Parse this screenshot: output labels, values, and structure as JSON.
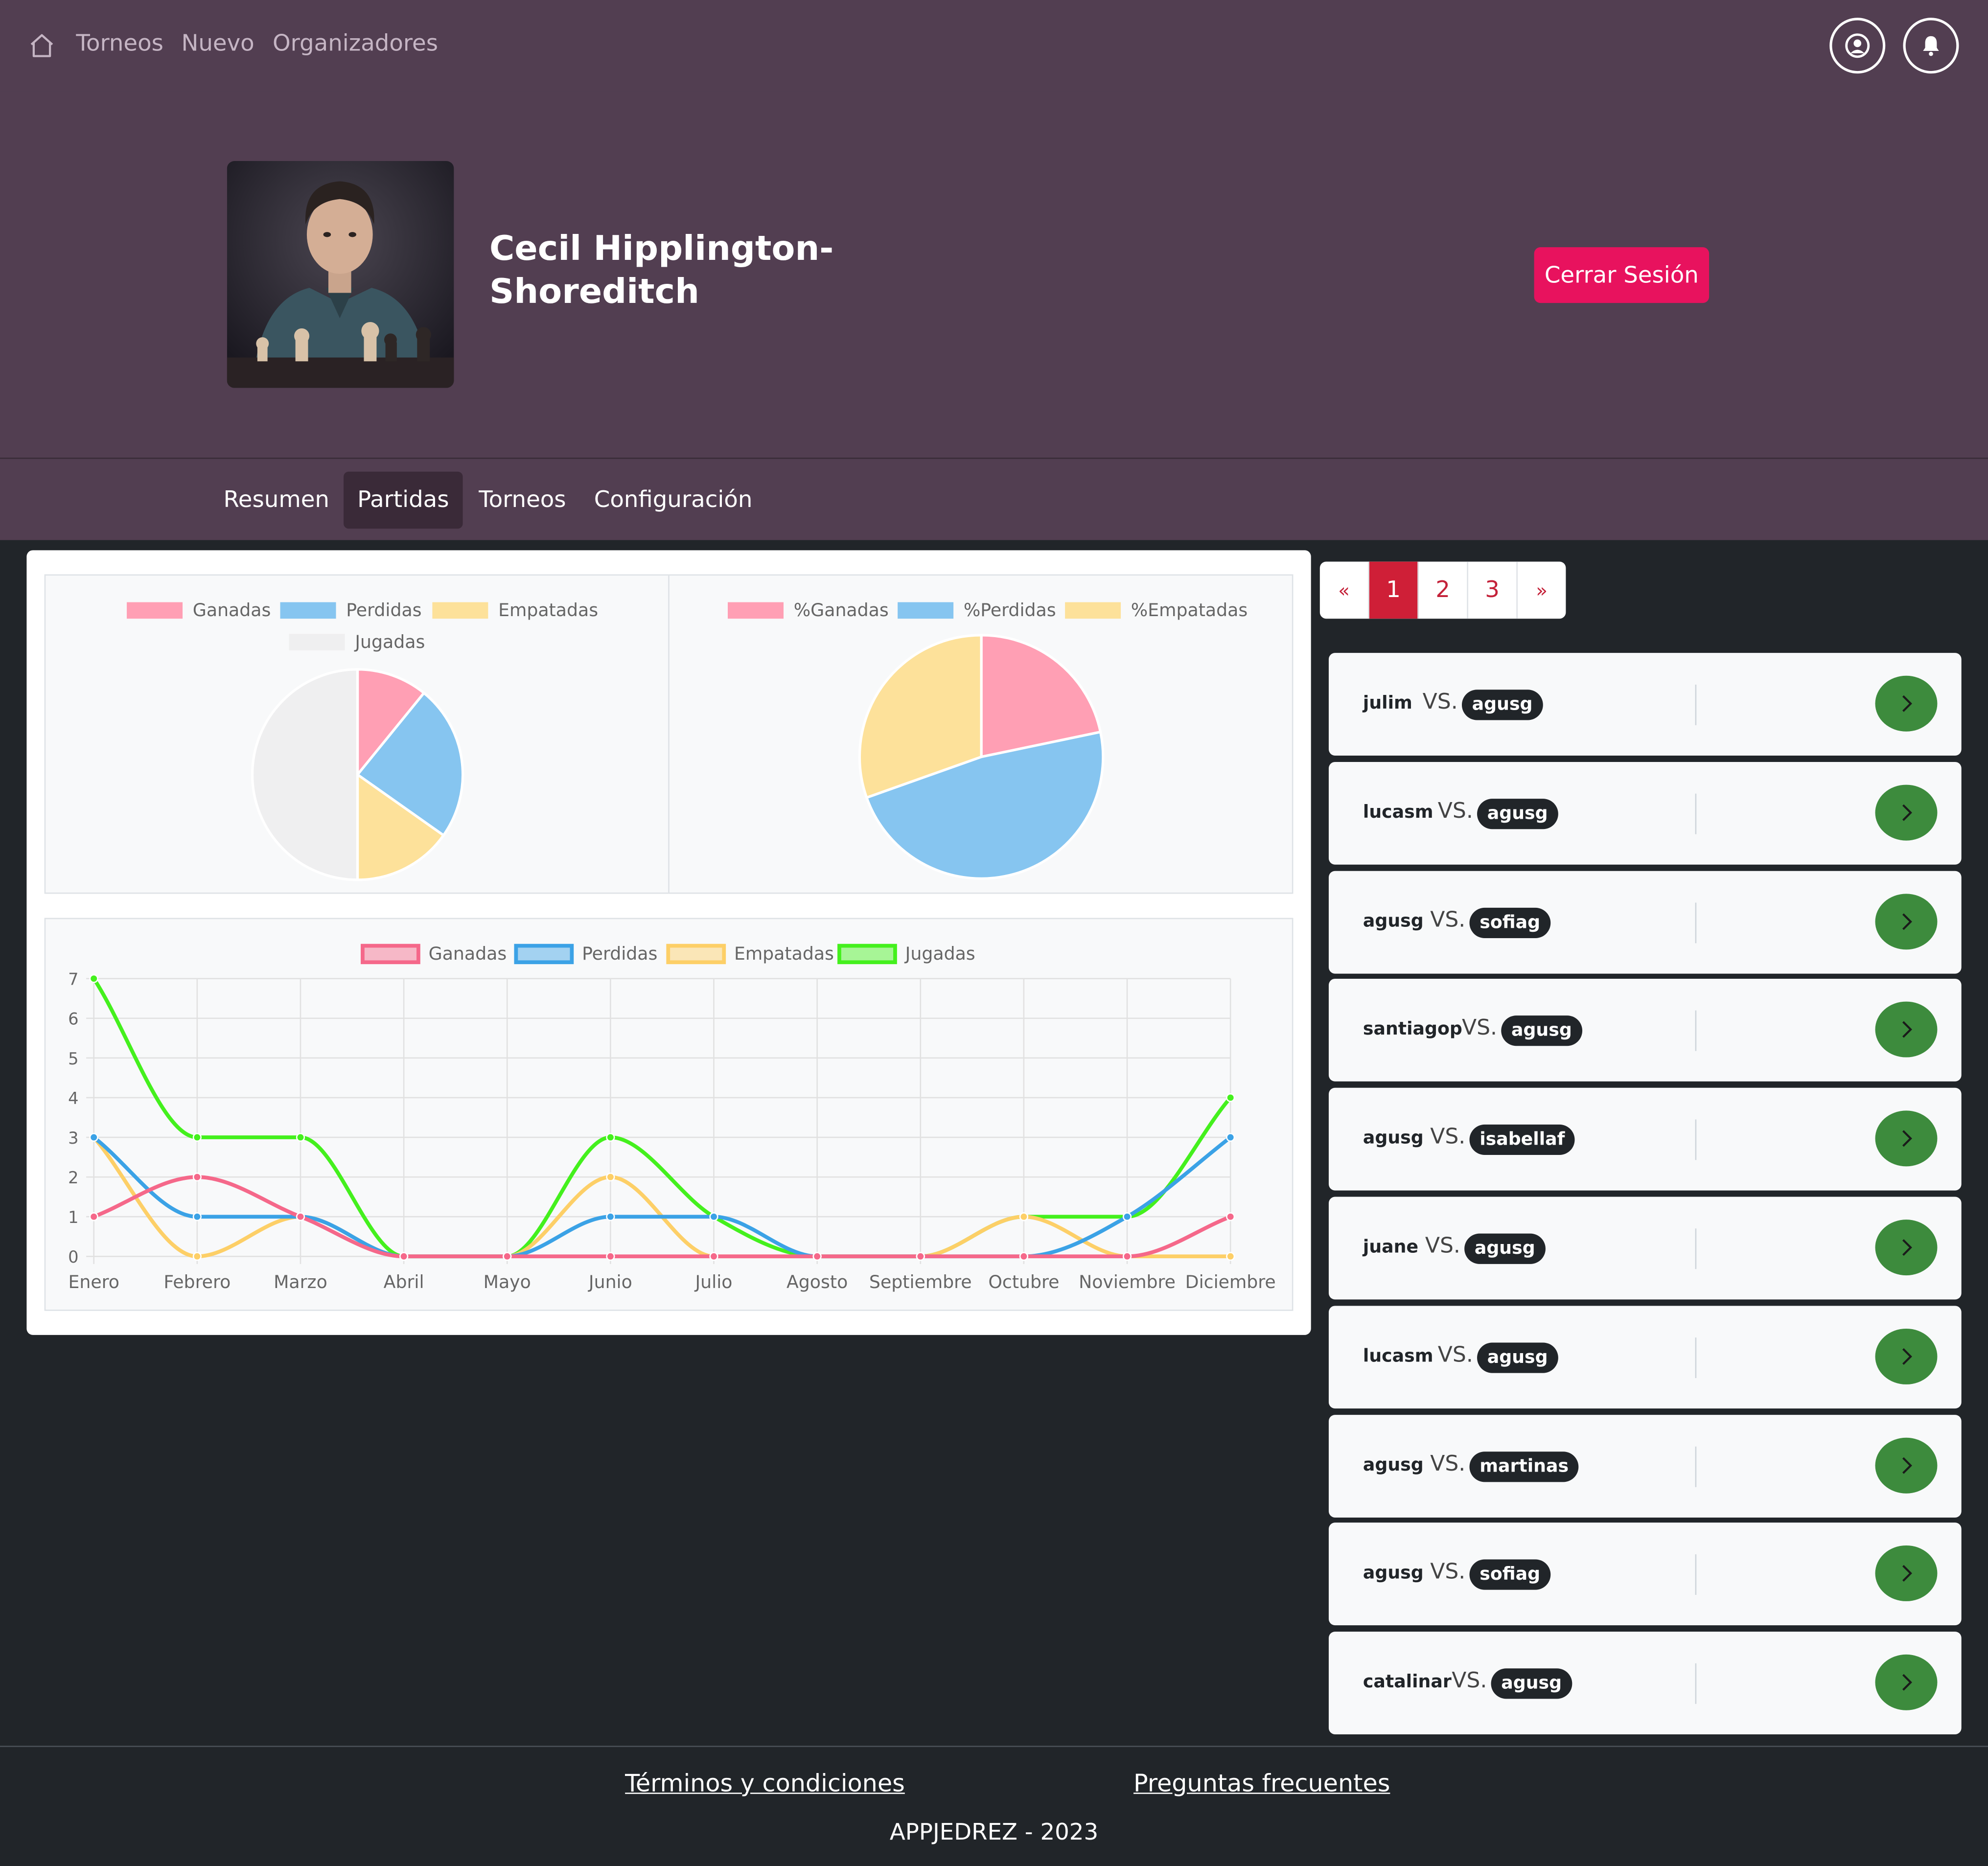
{
  "nav": {
    "home_icon": "home-icon",
    "links": [
      "Torneos",
      "Nuevo",
      "Organizadores"
    ],
    "user_icon": "user-circle-icon",
    "bell_icon": "bell-icon"
  },
  "profile": {
    "name": "Cecil Hipplington-Shoreditch",
    "logout_label": "Cerrar Sesión",
    "logout_color": "#e8125e"
  },
  "tabs": [
    {
      "label": "Resumen",
      "active": false
    },
    {
      "label": "Partidas",
      "active": true
    },
    {
      "label": "Torneos",
      "active": false
    },
    {
      "label": "Configuración",
      "active": false
    }
  ],
  "chart_data": [
    {
      "type": "pie",
      "legend": [
        "Ganadas",
        "Perdidas",
        "Empatadas",
        "Jugadas"
      ],
      "labels": [
        "Ganadas",
        "Perdidas",
        "Empatadas",
        "Jugadas"
      ],
      "values": [
        5,
        11,
        7,
        23
      ],
      "colors": [
        "#ff9fb4",
        "#86c5f0",
        "#fde19a",
        "#efeff0"
      ],
      "legend_position": "top"
    },
    {
      "type": "pie",
      "legend": [
        "%Ganadas",
        "%Perdidas",
        "%Empatadas"
      ],
      "labels": [
        "%Ganadas",
        "%Perdidas",
        "%Empatadas"
      ],
      "values": [
        21.7,
        47.8,
        30.4
      ],
      "colors": [
        "#ff9fb4",
        "#86c5f0",
        "#fde19a"
      ],
      "legend_position": "top"
    },
    {
      "type": "line",
      "categories": [
        "Enero",
        "Febrero",
        "Marzo",
        "Abril",
        "Mayo",
        "Junio",
        "Julio",
        "Agosto",
        "Septiembre",
        "Octubre",
        "Noviembre",
        "Diciembre"
      ],
      "series": [
        {
          "name": "Ganadas",
          "values": [
            1,
            2,
            1,
            0,
            0,
            0,
            0,
            0,
            0,
            0,
            0,
            1
          ],
          "color": "#f5688a"
        },
        {
          "name": "Perdidas",
          "values": [
            3,
            1,
            1,
            0,
            0,
            1,
            1,
            0,
            0,
            0,
            1,
            3
          ],
          "color": "#3ba2e6"
        },
        {
          "name": "Empatadas",
          "values": [
            3,
            0,
            1,
            0,
            0,
            2,
            0,
            0,
            0,
            1,
            0,
            0
          ],
          "color": "#fdcf67"
        },
        {
          "name": "Jugadas",
          "values": [
            7,
            3,
            3,
            0,
            0,
            3,
            1,
            0,
            0,
            1,
            1,
            4
          ],
          "color": "#44f01d"
        }
      ],
      "ylim": [
        0,
        7
      ],
      "yticks": [
        "0",
        "1",
        "2",
        "3",
        "4",
        "5",
        "6",
        "7"
      ],
      "grid": true,
      "legend_position": "top"
    }
  ],
  "pagination": {
    "prev": "«",
    "pages": [
      "1",
      "2",
      "3"
    ],
    "active": "1",
    "next": "»"
  },
  "matches": [
    {
      "left": "julim",
      "vs": "VS.",
      "right": "agusg"
    },
    {
      "left": "lucasm",
      "vs": "VS.",
      "right": "agusg"
    },
    {
      "left": "agusg",
      "vs": "VS.",
      "right": "sofiag"
    },
    {
      "left": "santiagop",
      "vs": "VS.",
      "right": "agusg"
    },
    {
      "left": "agusg",
      "vs": "VS.",
      "right": "isabellaf"
    },
    {
      "left": "juane",
      "vs": "VS.",
      "right": "agusg"
    },
    {
      "left": "lucasm",
      "vs": "VS.",
      "right": "agusg"
    },
    {
      "left": "agusg",
      "vs": "VS.",
      "right": "martinas"
    },
    {
      "left": "agusg",
      "vs": "VS.",
      "right": "sofiag"
    },
    {
      "left": "catalinar",
      "vs": "VS.",
      "right": "agusg"
    }
  ],
  "match_go_icon": "chevron-right-icon",
  "footer": {
    "terms": "Términos y condiciones",
    "faq": "Preguntas frecuentes",
    "copyright": "APPJEDREZ - 2023"
  }
}
